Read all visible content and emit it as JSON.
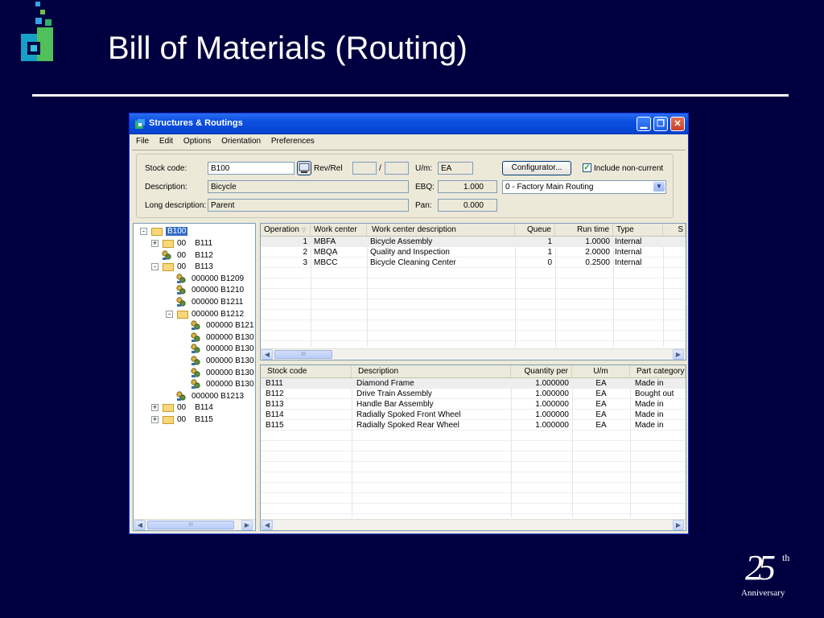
{
  "slide": {
    "title": "Bill of Materials (Routing)",
    "anniversary_number": "25",
    "anniversary_suffix": "th",
    "anniversary_word": "Anniversary"
  },
  "colors": {
    "background": "#000040",
    "title_bar": "#0a4ee0",
    "selection": "#316ac5"
  },
  "window": {
    "title": "Structures & Routings",
    "menu": [
      "File",
      "Edit",
      "Options",
      "Orientation",
      "Preferences"
    ]
  },
  "form": {
    "stock_code_label": "Stock code:",
    "stock_code": "B100",
    "rev_rel_label": "Rev/Rel",
    "rev": "",
    "rel": "",
    "slash": "/",
    "um_label": "U/m:",
    "um": "EA",
    "configurator_label": "Configurator...",
    "include_noncurrent_label": "Include non-current",
    "include_noncurrent_checked": true,
    "description_label": "Description:",
    "description": "Bicycle",
    "ebq_label": "EBQ:",
    "ebq": "1.000",
    "routing_select": "0 - Factory Main Routing",
    "long_description_label": "Long description:",
    "long_description": "Parent",
    "pan_label": "Pan:",
    "pan": "0.000"
  },
  "tree": {
    "root": "B100",
    "nodes": [
      {
        "text": "00    B111",
        "icon": "folder-icon",
        "toggle": "+"
      },
      {
        "text": "00    B112",
        "icon": "part-icon",
        "toggle": ""
      },
      {
        "text": "00    B113",
        "icon": "folder-icon",
        "toggle": "-"
      },
      {
        "text": "000000 B1209",
        "icon": "part-icon",
        "toggle": ""
      },
      {
        "text": "000000 B1210",
        "icon": "part-icon",
        "toggle": ""
      },
      {
        "text": "000000 B1211",
        "icon": "part-icon",
        "toggle": ""
      },
      {
        "text": "000000 B1212",
        "icon": "folder-icon",
        "toggle": "-"
      },
      {
        "text": "000000 B121",
        "icon": "part-icon",
        "toggle": ""
      },
      {
        "text": "000000 B130",
        "icon": "part-icon",
        "toggle": ""
      },
      {
        "text": "000000 B130",
        "icon": "part-icon",
        "toggle": ""
      },
      {
        "text": "000000 B130",
        "icon": "part-icon",
        "toggle": ""
      },
      {
        "text": "000000 B130",
        "icon": "part-icon",
        "toggle": ""
      },
      {
        "text": "000000 B130",
        "icon": "part-icon",
        "toggle": ""
      },
      {
        "text": "000000 B1213",
        "icon": "part-icon",
        "toggle": ""
      },
      {
        "text": "00    B114",
        "icon": "folder-icon",
        "toggle": "+"
      },
      {
        "text": "00    B115",
        "icon": "folder-icon",
        "toggle": "+"
      }
    ]
  },
  "routing_grid": {
    "headers": [
      "Operation",
      "Work center",
      "Work center description",
      "Queue",
      "Run time",
      "Type",
      "S"
    ],
    "rows": [
      [
        "1",
        "MBFA",
        "Bicycle Assembly",
        "1",
        "1.0000",
        "Internal"
      ],
      [
        "2",
        "MBQA",
        "Quality and Inspection",
        "1",
        "2.0000",
        "Internal"
      ],
      [
        "3",
        "MBCC",
        "Bicycle Cleaning Center",
        "0",
        "0.2500",
        "Internal"
      ]
    ]
  },
  "components_grid": {
    "headers": [
      "Stock code",
      "Description",
      "Quantity per",
      "U/m",
      "Part category"
    ],
    "rows": [
      [
        "B111",
        "Diamond Frame",
        "1.000000",
        "EA",
        "Made in"
      ],
      [
        "B112",
        "Drive Train Assembly",
        "1.000000",
        "EA",
        "Bought out"
      ],
      [
        "B113",
        "Handle Bar Assembly",
        "1.000000",
        "EA",
        "Made in"
      ],
      [
        "B114",
        "Radially Spoked Front Wheel",
        "1.000000",
        "EA",
        "Made in"
      ],
      [
        "B115",
        "Radially Spoked Rear Wheel",
        "1.000000",
        "EA",
        "Made in"
      ]
    ]
  },
  "scroll_thumb_label": "III"
}
